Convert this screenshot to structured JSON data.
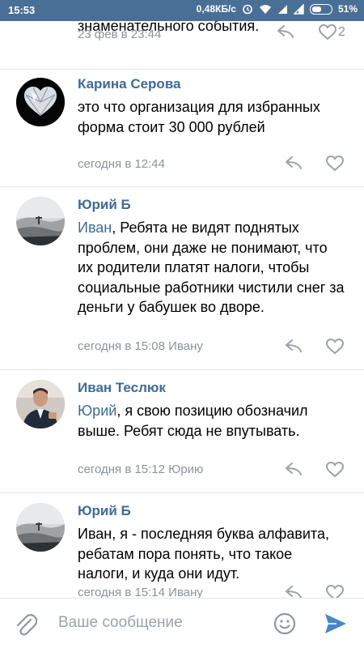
{
  "status": {
    "time": "15:53",
    "net_speed": "0,48КБ/с",
    "battery_percent": "51%",
    "battery_level": 0.51
  },
  "comments": [
    {
      "author": "",
      "text": "знаменательного события.",
      "date": "23 фев в 23:44",
      "likes": "2"
    },
    {
      "author": "Карина Серова",
      "mention": "",
      "text": "это что организация для избранных форма стоит 30 000 рублей",
      "date": "сегодня в 12:44"
    },
    {
      "author": "Юрий Б",
      "mention": "Иван",
      "text": ", Ребята не видят поднятых проблем, они даже не понимают, что их родители платят налоги, чтобы социальные работники чистили снег за деньги у бабушек во дворе.",
      "date": "сегодня в 15:08 Ивану"
    },
    {
      "author": "Иван Теслюк",
      "mention": "Юрий",
      "text": ", я свою позицию обозначил выше. Ребят сюда не впутывать.",
      "date": "сегодня в 15:12 Юрию"
    },
    {
      "author": "Юрий Б",
      "mention": "",
      "text": "Иван, я - последняя буква алфавита, ребатам пора понять, что такое налоги, и куда они идут.",
      "date": "сегодня в 15:14 Ивану"
    }
  ],
  "composer": {
    "placeholder": "Ваше сообщение"
  },
  "colors": {
    "status_bar": "#4a6f96",
    "link": "#3f6b98",
    "meta": "#8a929b",
    "send": "#4a86c5"
  }
}
